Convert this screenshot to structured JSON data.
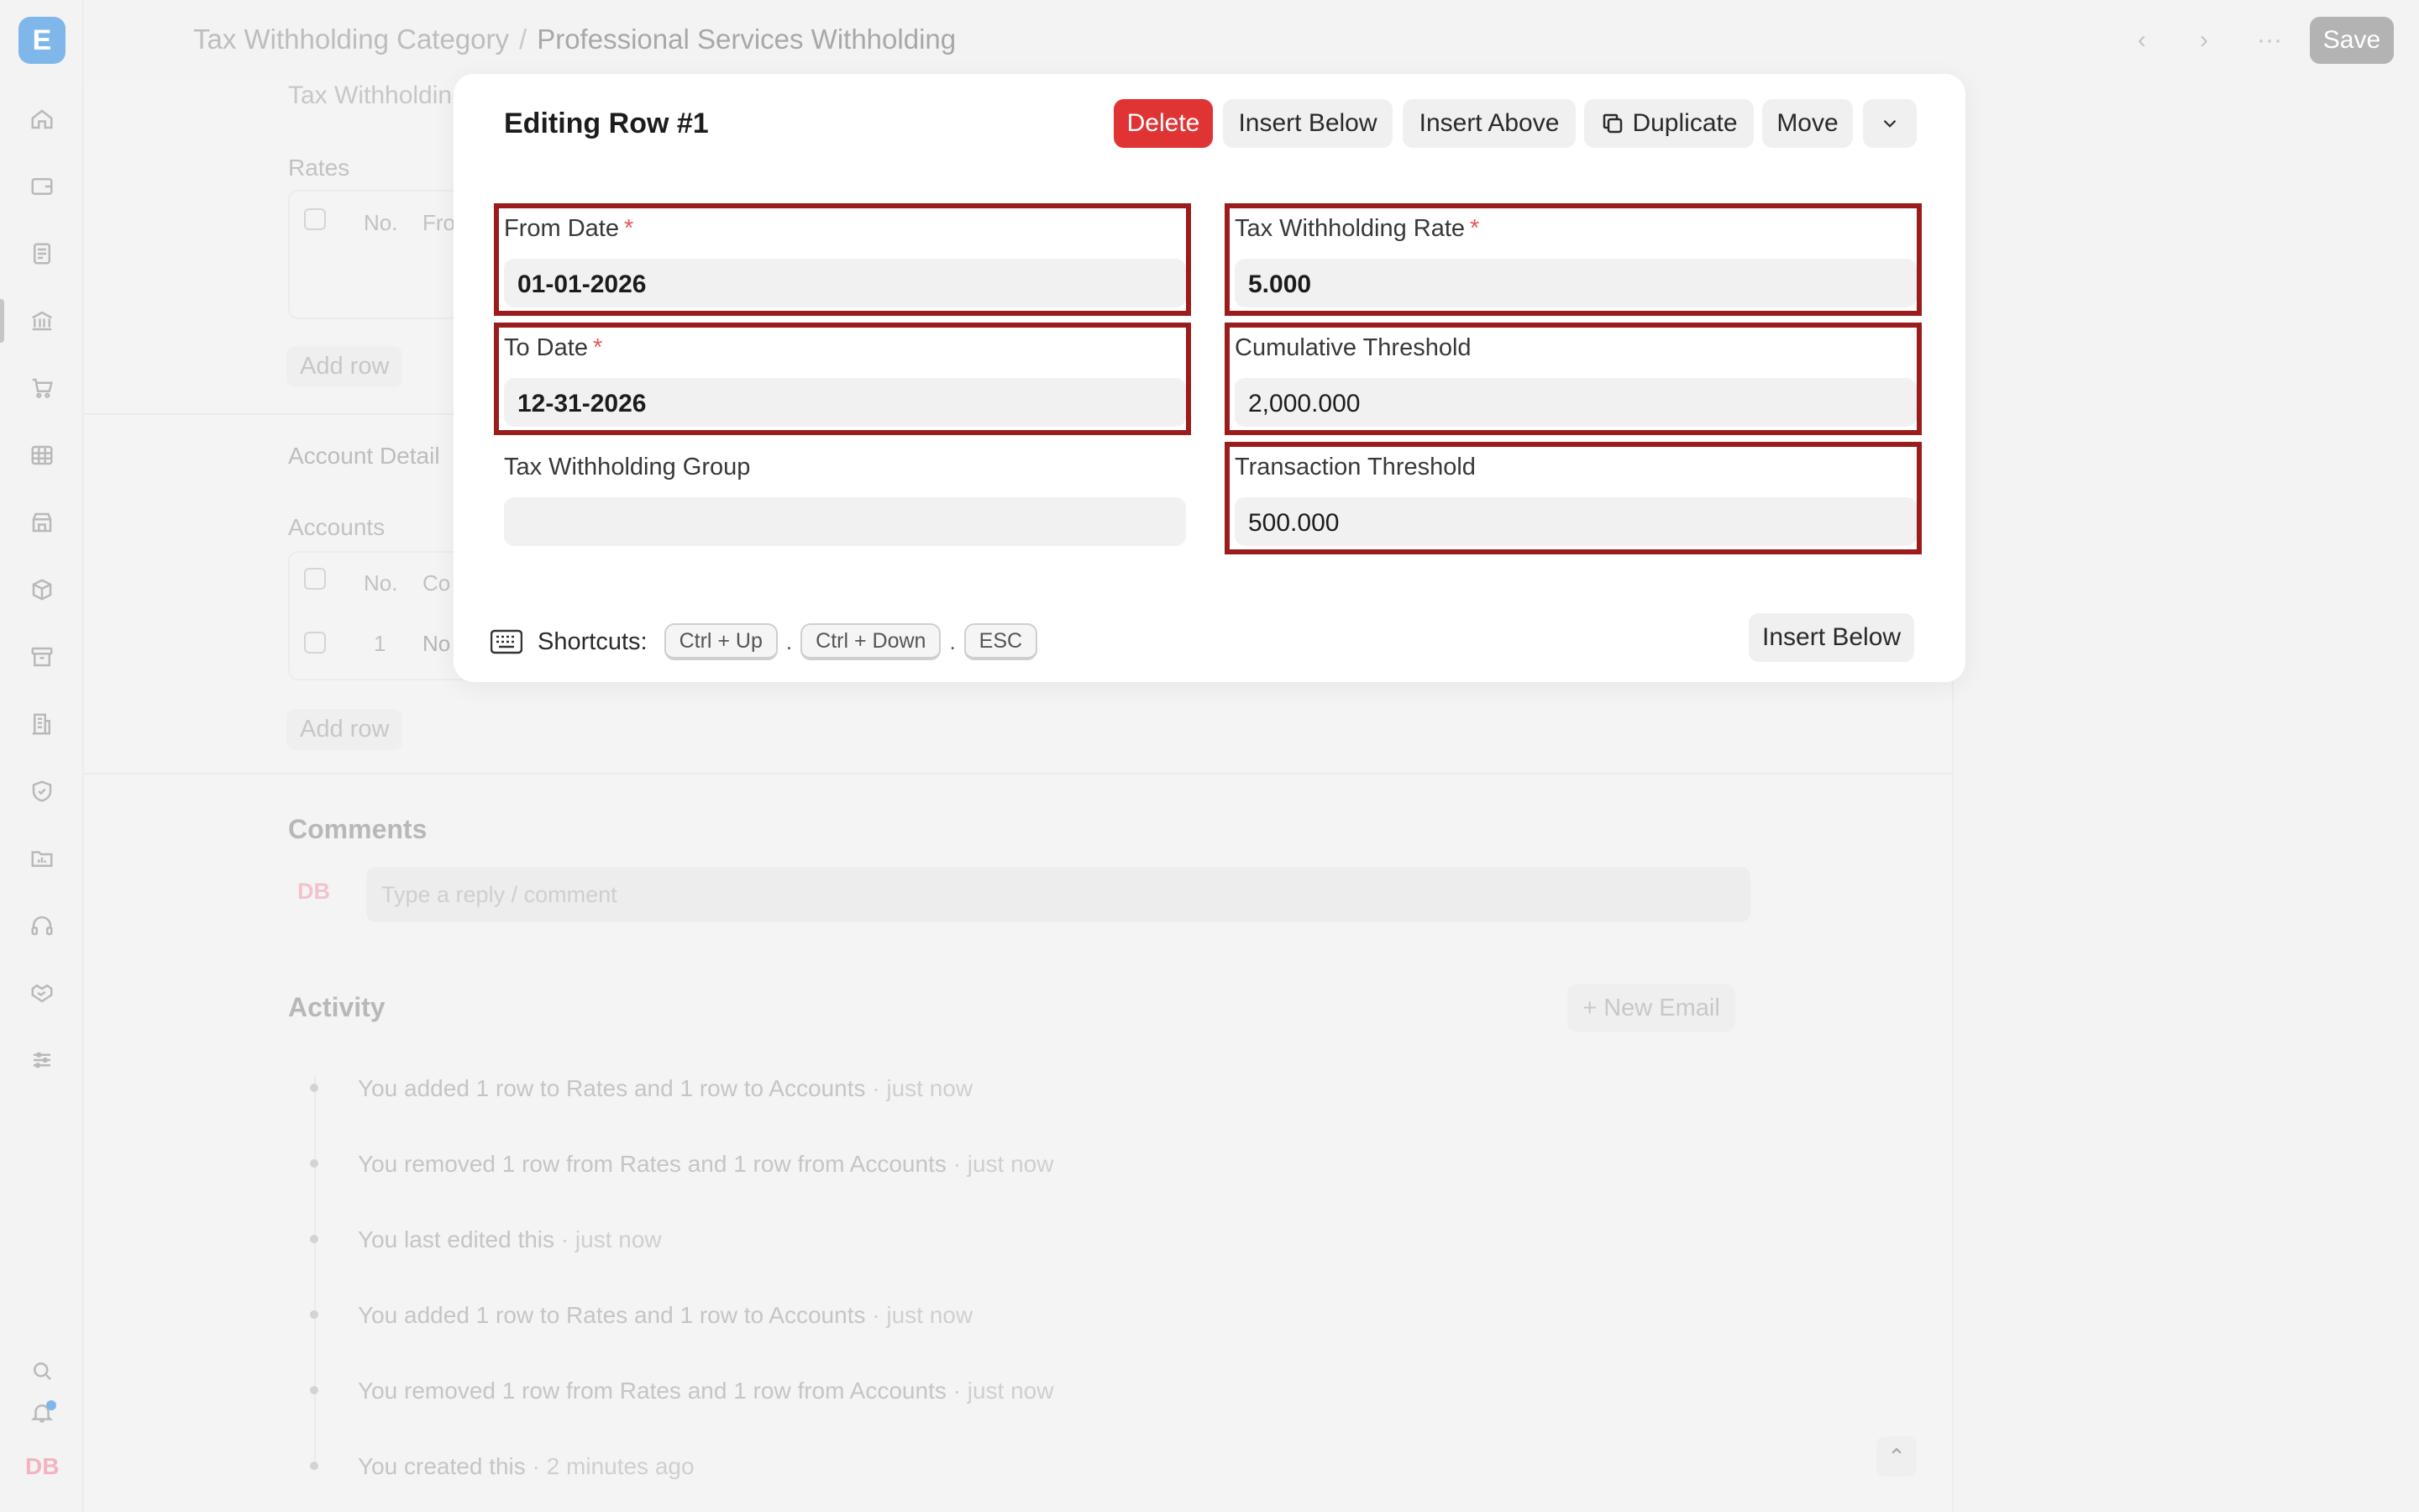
{
  "app": {
    "logo_letter": "E",
    "user_initials": "DB"
  },
  "breadcrumb": {
    "parent": "Tax Withholding Category",
    "separator": "/",
    "current": "Professional Services Withholding"
  },
  "toolbar": {
    "save_label": "Save",
    "more_label": "···"
  },
  "sidebar": {
    "icons": [
      "home-icon",
      "wallet-icon",
      "document-icon",
      "bank-icon",
      "cart-icon",
      "table-icon",
      "store-icon",
      "package-icon",
      "archive-icon",
      "building-icon",
      "shield-icon",
      "folder-chart-icon",
      "headset-icon",
      "handshake-icon",
      "sliders-icon",
      "search-icon",
      "bell-icon"
    ]
  },
  "background_form": {
    "section1_title": "Tax Withholdin",
    "rates_label": "Rates",
    "rates_header": [
      "No.",
      "Fro"
    ],
    "add_row_label": "Add row",
    "account_details_title": "Account Detail",
    "accounts_label": "Accounts",
    "accounts_header": [
      "No.",
      "Co"
    ],
    "accounts_row": [
      "1",
      "No"
    ],
    "comments_title": "Comments",
    "comment_placeholder": "Type a reply / comment",
    "activity_title": "Activity",
    "new_email_label": "+ New Email",
    "activity": [
      {
        "text": "You added 1 row to Rates and 1 row to Accounts",
        "time": "· just now"
      },
      {
        "text": "You removed 1 row from Rates and 1 row from Accounts",
        "time": "· just now"
      },
      {
        "text": "You last edited this",
        "time": "· just now"
      },
      {
        "text": "You added 1 row to Rates and 1 row to Accounts",
        "time": "· just now"
      },
      {
        "text": "You removed 1 row from Rates and 1 row from Accounts",
        "time": "· just now"
      },
      {
        "text": "You created this",
        "time": "· 2 minutes ago"
      }
    ]
  },
  "modal": {
    "title": "Editing Row #1",
    "buttons": {
      "delete": "Delete",
      "insert_below": "Insert Below",
      "insert_above": "Insert Above",
      "duplicate": "Duplicate",
      "move": "Move"
    },
    "fields": {
      "from_date": {
        "label": "From Date",
        "required": "*",
        "value": "01-01-2026"
      },
      "to_date": {
        "label": "To Date",
        "required": "*",
        "value": "12-31-2026"
      },
      "tax_withholding_group": {
        "label": "Tax Withholding Group",
        "value": ""
      },
      "tax_withholding_rate": {
        "label": "Tax Withholding Rate",
        "required": "*",
        "value": "5.000"
      },
      "cumulative_threshold": {
        "label": "Cumulative Threshold",
        "value": "2,000.000"
      },
      "transaction_threshold": {
        "label": "Transaction Threshold",
        "value": "500.000"
      }
    },
    "shortcuts": {
      "label": "Shortcuts:",
      "keys": [
        "Ctrl + Up",
        "Ctrl + Down",
        "ESC"
      ],
      "sep": "."
    },
    "footer_button": "Insert Below"
  },
  "colors": {
    "highlight_border": "#9a1c1c",
    "danger": "#e03434",
    "accent": "#7fb7ea"
  }
}
